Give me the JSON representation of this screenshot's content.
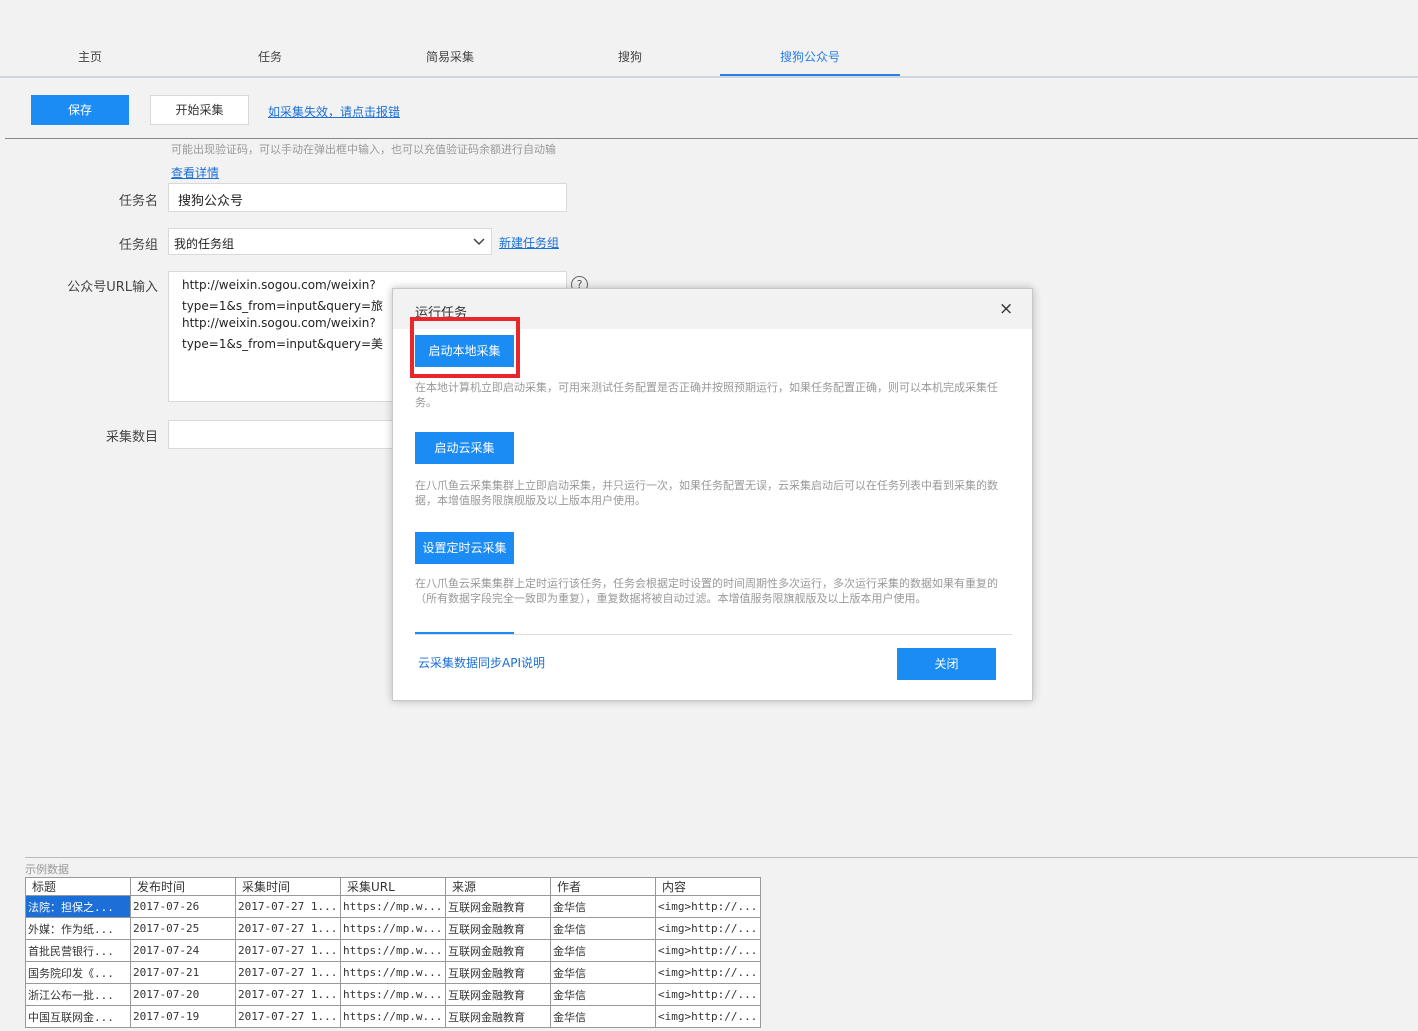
{
  "tabs": [
    "主页",
    "任务",
    "简易采集",
    "搜狗",
    "搜狗公众号"
  ],
  "active_tab_index": 4,
  "toolbar": {
    "save_label": "保存",
    "start_label": "开始采集",
    "report_link": "如采集失效，请点击报错"
  },
  "form": {
    "hint_text": "可能出现验证码，可以手动在弹出框中输入，也可以充值验证码余额进行自动输",
    "details_link": "查看详情",
    "task_name_label": "任务名",
    "task_name_value": "搜狗公众号",
    "task_group_label": "任务组",
    "task_group_value": "我的任务组",
    "new_group_link": "新建任务组",
    "url_label": "公众号URL输入",
    "url_lines": [
      "http://weixin.sogou.com/weixin?",
      "type=1&s_from=input&query=旅",
      "http://weixin.sogou.com/weixin?",
      "type=1&s_from=input&query=美"
    ],
    "count_label": "采集数目",
    "count_value": "",
    "help_icon": "?"
  },
  "modal": {
    "title": "运行任务",
    "close_icon": "×",
    "local_button": "启动本地采集",
    "local_desc": "在本地计算机立即启动采集，可用来测试任务配置是否正确并按照预期运行，如果任务配置正确，则可以本机完成采集任务。",
    "cloud_button": "启动云采集",
    "cloud_desc": "在八爪鱼云采集集群上立即启动采集，并只运行一次，如果任务配置无误，云采集启动后可以在任务列表中看到采集的数据，本增值服务限旗舰版及以上版本用户使用。",
    "schedule_button": "设置定时云采集",
    "schedule_desc": "在八爪鱼云采集集群上定时运行该任务，任务会根据定时设置的时间周期性多次运行，多次运行采集的数据如果有重复的（所有数据字段完全一致即为重复），重复数据将被自动过滤。本增值服务限旗舰版及以上版本用户使用。",
    "api_link": "云采集数据同步API说明",
    "close_button": "关闭"
  },
  "sample": {
    "title": "示例数据",
    "columns": [
      "标题",
      "发布时间",
      "采集时间",
      "采集URL",
      "来源",
      "作者",
      "内容"
    ],
    "rows": [
      [
        "法院：担保之...",
        "2017-07-26",
        "2017-07-27 1...",
        "https://mp.w...",
        "互联网金融教育",
        "金华信",
        "<img>http://..."
      ],
      [
        "外媒：作为纸...",
        "2017-07-25",
        "2017-07-27 1...",
        "https://mp.w...",
        "互联网金融教育",
        "金华信",
        "<img>http://..."
      ],
      [
        "首批民营银行...",
        "2017-07-24",
        "2017-07-27 1...",
        "https://mp.w...",
        "互联网金融教育",
        "金华信",
        "<img>http://..."
      ],
      [
        "国务院印发《...",
        "2017-07-21",
        "2017-07-27 1...",
        "https://mp.w...",
        "互联网金融教育",
        "金华信",
        "<img>http://..."
      ],
      [
        "浙江公布一批...",
        "2017-07-20",
        "2017-07-27 1...",
        "https://mp.w...",
        "互联网金融教育",
        "金华信",
        "<img>http://..."
      ],
      [
        "中国互联网金...",
        "2017-07-19",
        "2017-07-27 1...",
        "https://mp.w...",
        "互联网金融教育",
        "金华信",
        "<img>http://..."
      ]
    ]
  },
  "colors": {
    "accent": "#1c8cf5",
    "highlight_box": "#e8262c",
    "link": "#1a6fd6"
  }
}
